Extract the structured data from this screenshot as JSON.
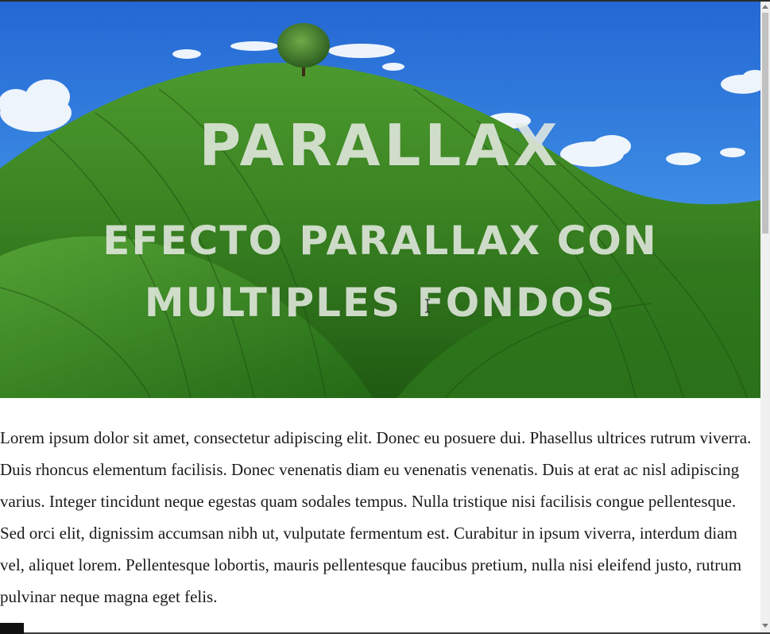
{
  "hero": {
    "title": "PARALLAX",
    "subtitle": "EFECTO PARALLAX CON MULTIPLES FONDOS"
  },
  "content": {
    "paragraph": "Lorem ipsum dolor sit amet, consectetur adipiscing elit. Donec eu posuere dui. Phasellus ultrices rutrum viverra. Duis rhoncus elementum facilisis. Donec venenatis diam eu venenatis venenatis. Duis at erat ac nisl adipiscing varius. Integer tincidunt neque egestas quam sodales tempus. Nulla tristique nisi facilisis congue pellentesque. Sed orci elit, dignissim accumsan nibh ut, vulputate fermentum est. Curabitur in ipsum viverra, interdum diam vel, aliquet lorem. Pellentesque lobortis, mauris pellentesque faucibus pretium, nulla nisi eleifend justo, rutrum pulvinar neque magna eget felis."
  },
  "colors": {
    "sky": "#2f7fd8",
    "grass": "#3f8a22",
    "title_text": "#e8ece4"
  },
  "icons": {
    "cursor": "text-cursor-icon",
    "scroll_up": "arrow-up-icon",
    "scroll_down": "arrow-down-icon"
  }
}
